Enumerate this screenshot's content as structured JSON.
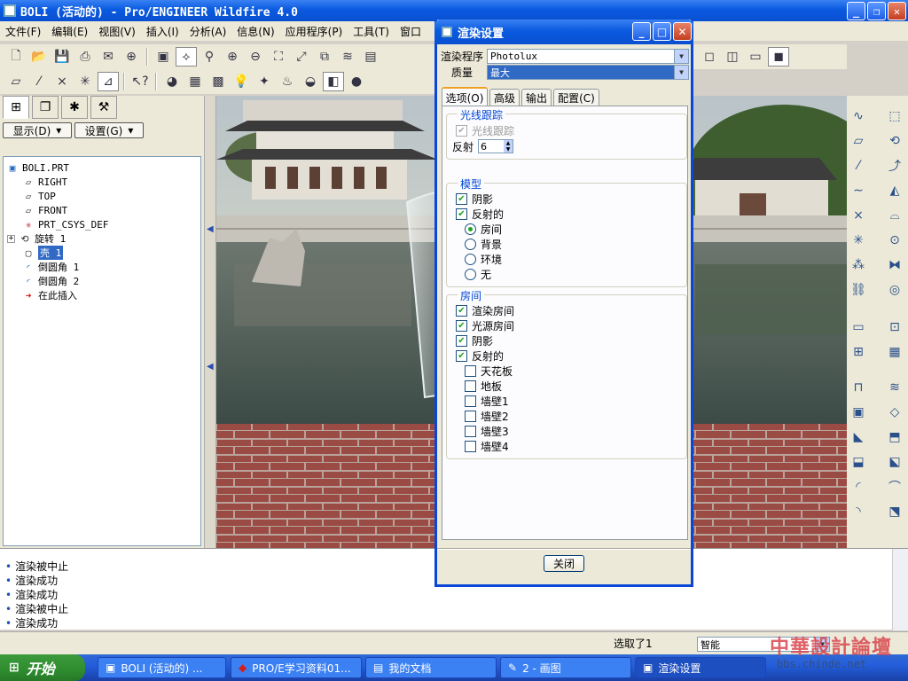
{
  "main_window": {
    "title": "BOLI (活动的) - Pro/ENGINEER Wildfire 4.0",
    "menu": [
      "文件(F)",
      "编辑(E)",
      "视图(V)",
      "插入(I)",
      "分析(A)",
      "信息(N)",
      "应用程序(P)",
      "工具(T)",
      "窗口"
    ]
  },
  "left_panel": {
    "display_button": "显示(D)",
    "settings_button": "设置(G)",
    "tree": [
      {
        "label": "BOLI.PRT",
        "icon": "part-icon"
      },
      {
        "label": "RIGHT",
        "icon": "datum-plane-icon"
      },
      {
        "label": "TOP",
        "icon": "datum-plane-icon"
      },
      {
        "label": "FRONT",
        "icon": "datum-plane-icon"
      },
      {
        "label": "PRT_CSYS_DEF",
        "icon": "csys-icon"
      },
      {
        "label": "旋转 1",
        "icon": "revolve-icon"
      },
      {
        "label": "壳 1",
        "icon": "shell-icon"
      },
      {
        "label": "倒圆角 1",
        "icon": "round-icon"
      },
      {
        "label": "倒圆角 2",
        "icon": "round-icon"
      },
      {
        "label": "在此插入",
        "icon": "insert-here-icon"
      }
    ]
  },
  "messages": [
    "渲染被中止",
    "渲染成功",
    "渲染成功",
    "渲染被中止",
    "渲染成功"
  ],
  "status": {
    "selected": "选取了1",
    "filter": "智能"
  },
  "taskbar": {
    "start": "开始",
    "buttons": [
      "BOLI (活动的) ...",
      "PRO/E学习资料01...",
      "我的文档",
      "2 - 画图",
      "渲染设置"
    ]
  },
  "dialog": {
    "title": "渲染设置",
    "renderer_label": "渲染程序",
    "renderer_value": "Photolux",
    "quality_label": "质量",
    "quality_value": "最大",
    "tabs": [
      "选项(O)",
      "高级",
      "输出",
      "配置(C)"
    ],
    "raytrace": {
      "group_title": "光线跟踪",
      "checkbox": "光线跟踪",
      "reflect_label": "反射",
      "reflect_value": "6"
    },
    "model": {
      "group_title": "模型",
      "shadow": "阴影",
      "reflective": "反射的",
      "options": [
        "房间",
        "背景",
        "环境",
        "无"
      ]
    },
    "room": {
      "group_title": "房间",
      "render_room": "渲染房间",
      "light_room": "光源房间",
      "shadow": "阴影",
      "reflective": "反射的",
      "surfaces": [
        "天花板",
        "地板",
        "墙壁1",
        "墙壁2",
        "墙壁3",
        "墙壁4"
      ]
    },
    "close_button": "关闭"
  },
  "watermark": {
    "line1": "中華設計論壇",
    "line2": "bbs.chinde.net"
  }
}
